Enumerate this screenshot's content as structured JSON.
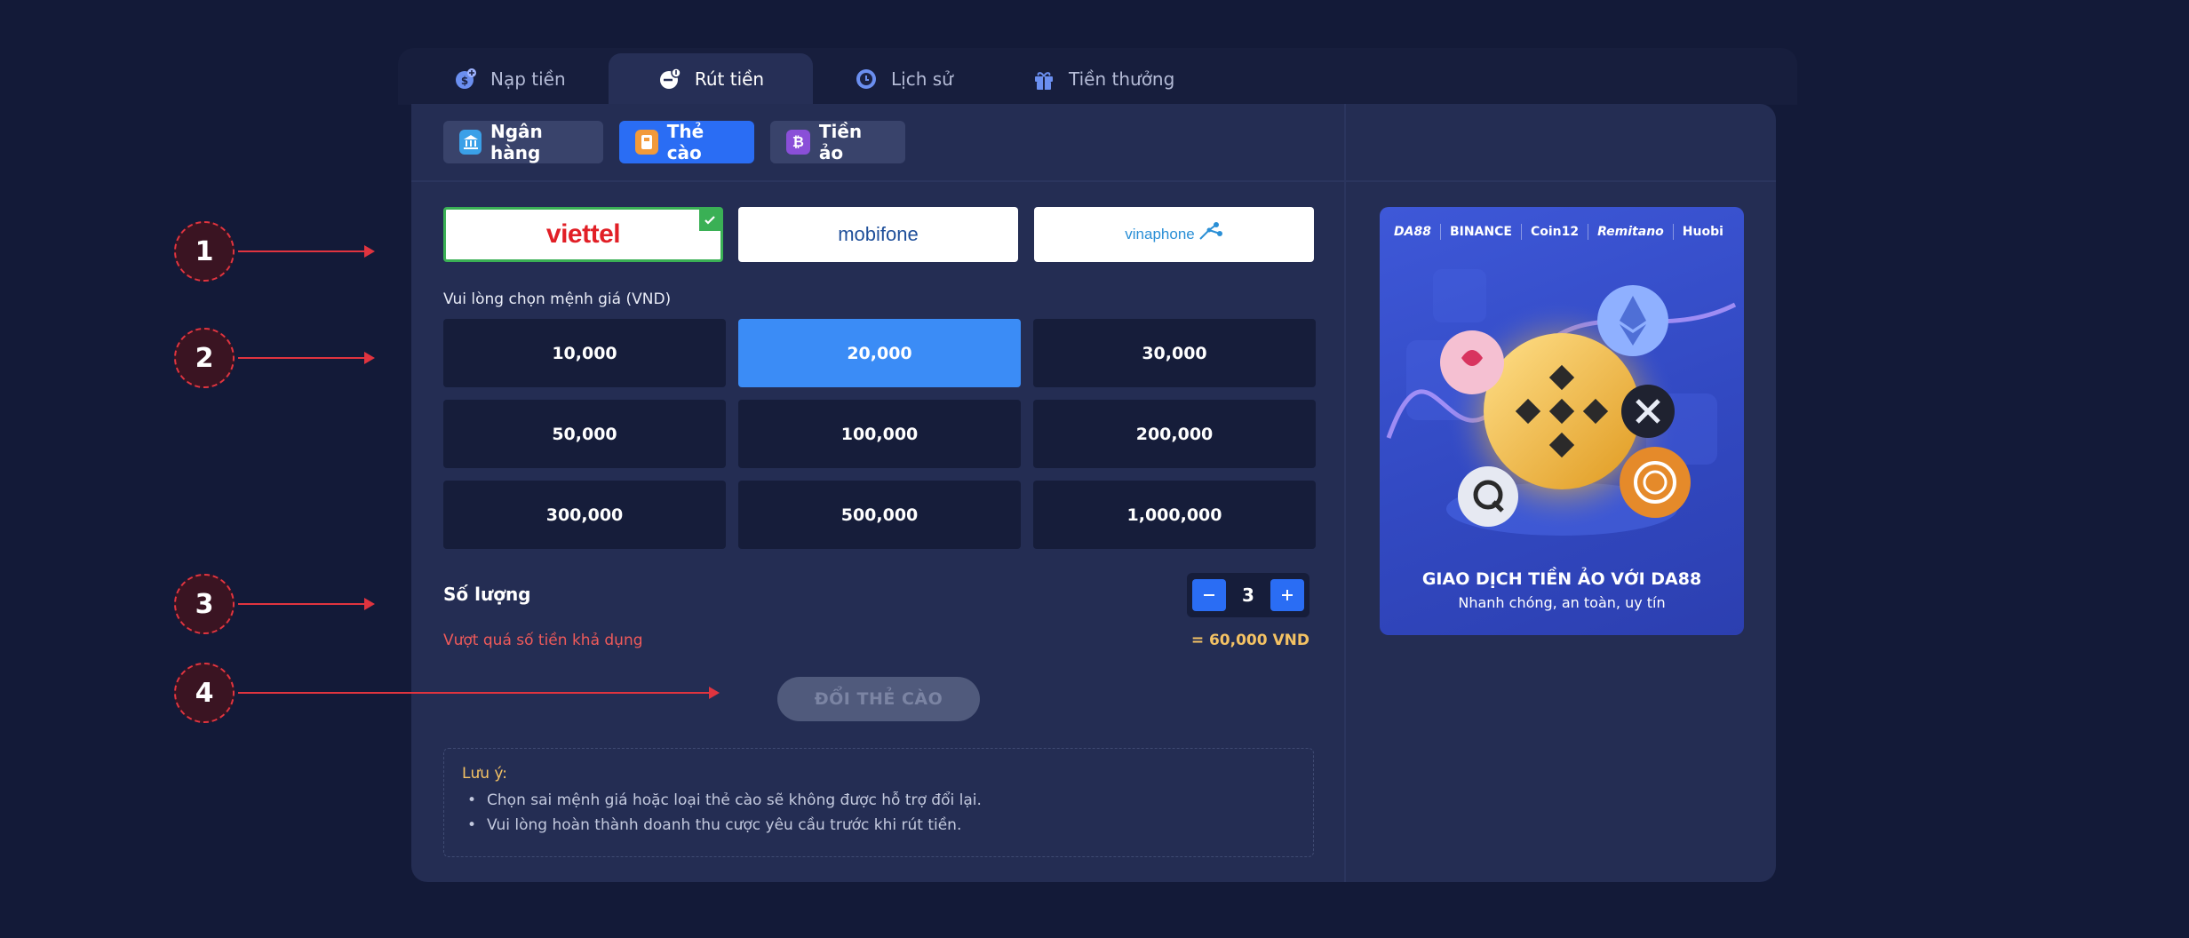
{
  "tabs": [
    {
      "label": "Nạp tiền",
      "icon": "coin-plus-icon"
    },
    {
      "label": "Rút tiền",
      "icon": "coin-withdraw-icon",
      "active": true
    },
    {
      "label": "Lịch sử",
      "icon": "clock-icon"
    },
    {
      "label": "Tiền thưởng",
      "icon": "gift-icon"
    }
  ],
  "subtabs": [
    {
      "label": "Ngân hàng",
      "icon": "bank-icon"
    },
    {
      "label": "Thẻ cào",
      "icon": "card-icon",
      "active": true
    },
    {
      "label": "Tiền ảo",
      "icon": "bitcoin-icon"
    }
  ],
  "carriers": [
    {
      "name": "viettel",
      "selected": true,
      "color": "#e11f26"
    },
    {
      "name": "mobifone",
      "selected": false,
      "color": "#1f4f9a"
    },
    {
      "name": "vinaphone",
      "selected": false,
      "color": "#2a8fd6"
    }
  ],
  "denomination_label": "Vui lòng chọn mệnh giá (VND)",
  "denominations": [
    "10,000",
    "20,000",
    "30,000",
    "50,000",
    "100,000",
    "200,000",
    "300,000",
    "500,000",
    "1,000,000"
  ],
  "selected_denomination": "20,000",
  "quantity": {
    "label": "Số lượng",
    "value": "3"
  },
  "warning": "Vượt quá số tiền khả dụng",
  "total": "= 60,000 VND",
  "submit_label": "ĐỔI THẺ CÀO",
  "note": {
    "title": "Lưu ý:",
    "items": [
      "Chọn sai mệnh giá hoặc loại thẻ cào sẽ không được hỗ trợ đổi lại.",
      "Vui lòng hoàn thành doanh thu cược yêu cầu trước khi rút tiền."
    ]
  },
  "promo": {
    "brands": [
      "DA88",
      "BINANCE",
      "Coin12",
      "Remitano",
      "Huobi"
    ],
    "title": "GIAO DỊCH TIỀN ẢO VỚI DA88",
    "subtitle": "Nhanh chóng, an toàn, uy tín"
  },
  "annotations": [
    "1",
    "2",
    "3",
    "4"
  ],
  "colors": {
    "background": "#131a38",
    "panel": "#242d53",
    "accent": "#2a6df4",
    "selected_denom": "#3b8cf6",
    "success": "#3ab055",
    "warning": "#ef5a5a",
    "gold": "#f4c264",
    "annotation": "#e0343f"
  }
}
